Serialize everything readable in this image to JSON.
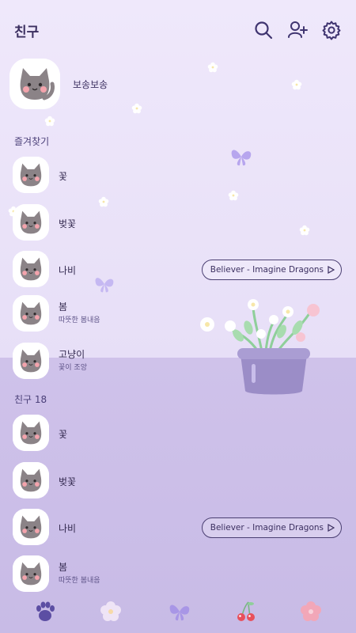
{
  "header": {
    "title": "친구",
    "icons": [
      "search-icon",
      "add-friend-icon",
      "settings-icon"
    ]
  },
  "my_profile": {
    "name": "보송보송"
  },
  "favorites": {
    "title": "즐겨찾기",
    "items": [
      {
        "name": "꽃",
        "status": "",
        "music": ""
      },
      {
        "name": "벚꽃",
        "status": "",
        "music": ""
      },
      {
        "name": "나비",
        "status": "",
        "music": "Believer - Imagine Dragons"
      },
      {
        "name": "봄",
        "status": "따뜻한 봄내음",
        "music": ""
      },
      {
        "name": "고냥이",
        "status": "꽃이 조앙",
        "music": ""
      }
    ]
  },
  "friends": {
    "title": "친구 18",
    "items": [
      {
        "name": "꽃",
        "status": "",
        "music": ""
      },
      {
        "name": "벚꽃",
        "status": "",
        "music": ""
      },
      {
        "name": "나비",
        "status": "",
        "music": "Believer - Imagine Dragons"
      },
      {
        "name": "봄",
        "status": "따뜻한 봄내음",
        "music": ""
      }
    ]
  },
  "bottom_nav": [
    "paw-icon",
    "flower-icon",
    "butterfly-icon",
    "cherry-icon",
    "pink-flower-icon"
  ],
  "colors": {
    "background_top": "#efe8fb",
    "background_bottom": "#cfc2ea",
    "text": "#3b2f60",
    "accent_purple": "#8d7fc4",
    "pink": "#f2a7b8"
  }
}
